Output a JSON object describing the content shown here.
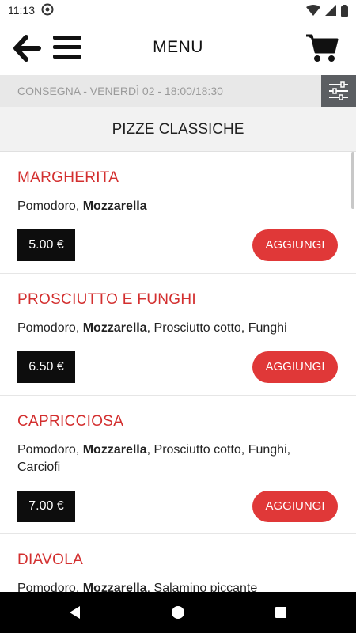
{
  "status_bar": {
    "time": "11:13"
  },
  "app_bar": {
    "title": "MENU"
  },
  "delivery": {
    "text": "CONSEGNA - VENERDÌ 02 - 18:00/18:30"
  },
  "category": {
    "title": "PIZZE CLASSICHE"
  },
  "items": [
    {
      "name": "MARGHERITA",
      "desc_pre": "Pomodoro, ",
      "desc_bold": "Mozzarella",
      "desc_post": "",
      "price": "5.00 €",
      "button": "AGGIUNGI"
    },
    {
      "name": "PROSCIUTTO E FUNGHI",
      "desc_pre": "Pomodoro, ",
      "desc_bold": "Mozzarella",
      "desc_post": ", Prosciutto cotto, Funghi",
      "price": "6.50 €",
      "button": "AGGIUNGI"
    },
    {
      "name": "CAPRICCIOSA",
      "desc_pre": "Pomodoro, ",
      "desc_bold": "Mozzarella",
      "desc_post": ", Prosciutto cotto, Funghi, Carciofi",
      "price": "7.00 €",
      "button": "AGGIUNGI"
    },
    {
      "name": "DIAVOLA",
      "desc_pre": "Pomodoro, ",
      "desc_bold": "Mozzarella",
      "desc_post": ", Salamino piccante",
      "price": "",
      "button": ""
    }
  ],
  "icons": {
    "back": "arrow-left-icon",
    "menu": "hamburger-menu-icon",
    "cart": "shopping-cart-icon",
    "filter": "filter-sliders-icon"
  },
  "colors": {
    "accent_red": "#d32f2f",
    "button_red": "#e03838",
    "price_bg": "#0d0d0d",
    "filter_bg": "#5b5e62"
  }
}
